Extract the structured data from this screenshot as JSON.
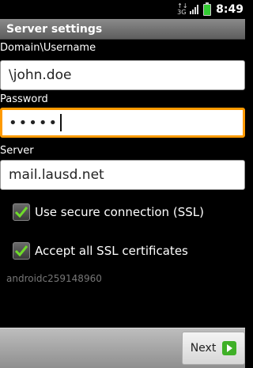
{
  "status_bar": {
    "network_label": "3G",
    "time": "8:49",
    "network_icon": "data-3g-icon",
    "signal_icon": "signal-strength-icon",
    "battery_icon": "battery-charging-icon"
  },
  "title": "Server settings",
  "fields": {
    "username": {
      "label": "Domain\\Username",
      "value": "\\john.doe"
    },
    "password": {
      "label": "Password",
      "value": "•••••"
    },
    "server": {
      "label": "Server",
      "value": "mail.lausd.net"
    }
  },
  "checkboxes": {
    "ssl": {
      "label": "Use secure connection (SSL)",
      "checked": true
    },
    "accept_certs": {
      "label": "Accept all SSL certificates",
      "checked": true
    }
  },
  "device_id": "androidc259148960",
  "footer": {
    "next_label": "Next",
    "next_icon": "arrow-right-icon"
  },
  "colors": {
    "focus_border": "#ff9a00",
    "check_green": "#6fdc2a",
    "next_icon_green": "#3fb027"
  }
}
